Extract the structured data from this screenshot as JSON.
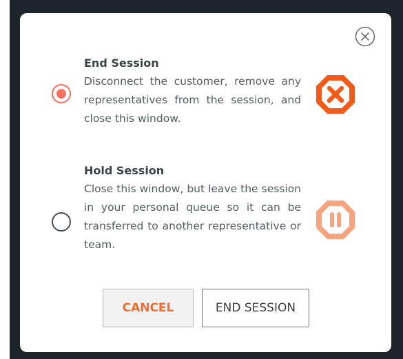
{
  "dialog": {
    "close_icon": "close-circle-icon",
    "options": [
      {
        "title": "End Session",
        "description": "Disconnect the customer, remove any representatives from the session, and close this window.",
        "selected": true,
        "icon": "octagon-x-icon",
        "icon_color": "#f05a1a"
      },
      {
        "title": "Hold Session",
        "description": "Close this window, but leave the session in your personal queue so it can be transferred to another representative or team.",
        "selected": false,
        "icon": "octagon-pause-icon",
        "icon_color": "#f6a380"
      }
    ],
    "buttons": {
      "cancel": "CANCEL",
      "end_session": "END SESSION"
    }
  },
  "colors": {
    "accent": "#ef6c2d",
    "radio_selected": "#f5725f",
    "backdrop": "#1f232c"
  }
}
